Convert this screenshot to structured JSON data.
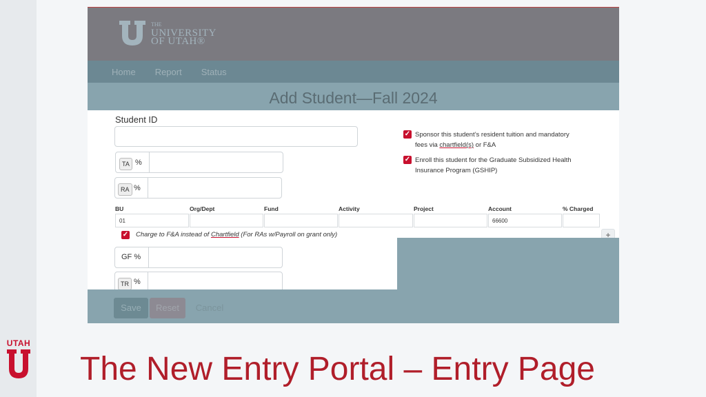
{
  "branding": {
    "univ_top": "THE",
    "univ_line1": "UNIVERSITY",
    "univ_line2": "OF UTAH®",
    "utah_word": "UTAH",
    "brand_color": "#c8102e"
  },
  "nav": {
    "items": [
      "Home",
      "Report",
      "Status"
    ]
  },
  "page": {
    "title": "Add Student—Fall 2024"
  },
  "form": {
    "student_id_label": "Student ID",
    "student_id_value": "",
    "ta_tag": "TA",
    "ra_tag": "RA",
    "tr_tag": "TR",
    "pct": "%",
    "gf_label": "GF %",
    "sponsor_check": {
      "text_a": "Sponsor this student’s resident tuition and mandatory",
      "text_b": "fees via ",
      "text_u": "chartfield(s)",
      "text_c": " or F&A"
    },
    "gship_check": {
      "line1": "Enroll this student for the Graduate Subsidized Health",
      "line2": "Insurance Program (GSHIP)"
    },
    "chartfield": {
      "headers": [
        "BU",
        "Org/Dept",
        "Fund",
        "Activity",
        "Project",
        "Account",
        "% Charged"
      ],
      "values": [
        "01",
        "",
        "",
        "",
        "",
        "66600",
        ""
      ]
    },
    "fa_check": {
      "text_a": "Charge to F&A instead of ",
      "text_u": "Chartfield",
      "text_c": " (For RAs w/Payroll on grant only)"
    },
    "plus": "+"
  },
  "buttons": {
    "save": "Save",
    "reset": "Reset",
    "cancel": "Cancel"
  },
  "slide": {
    "title": "The New Entry Portal – Entry Page"
  }
}
